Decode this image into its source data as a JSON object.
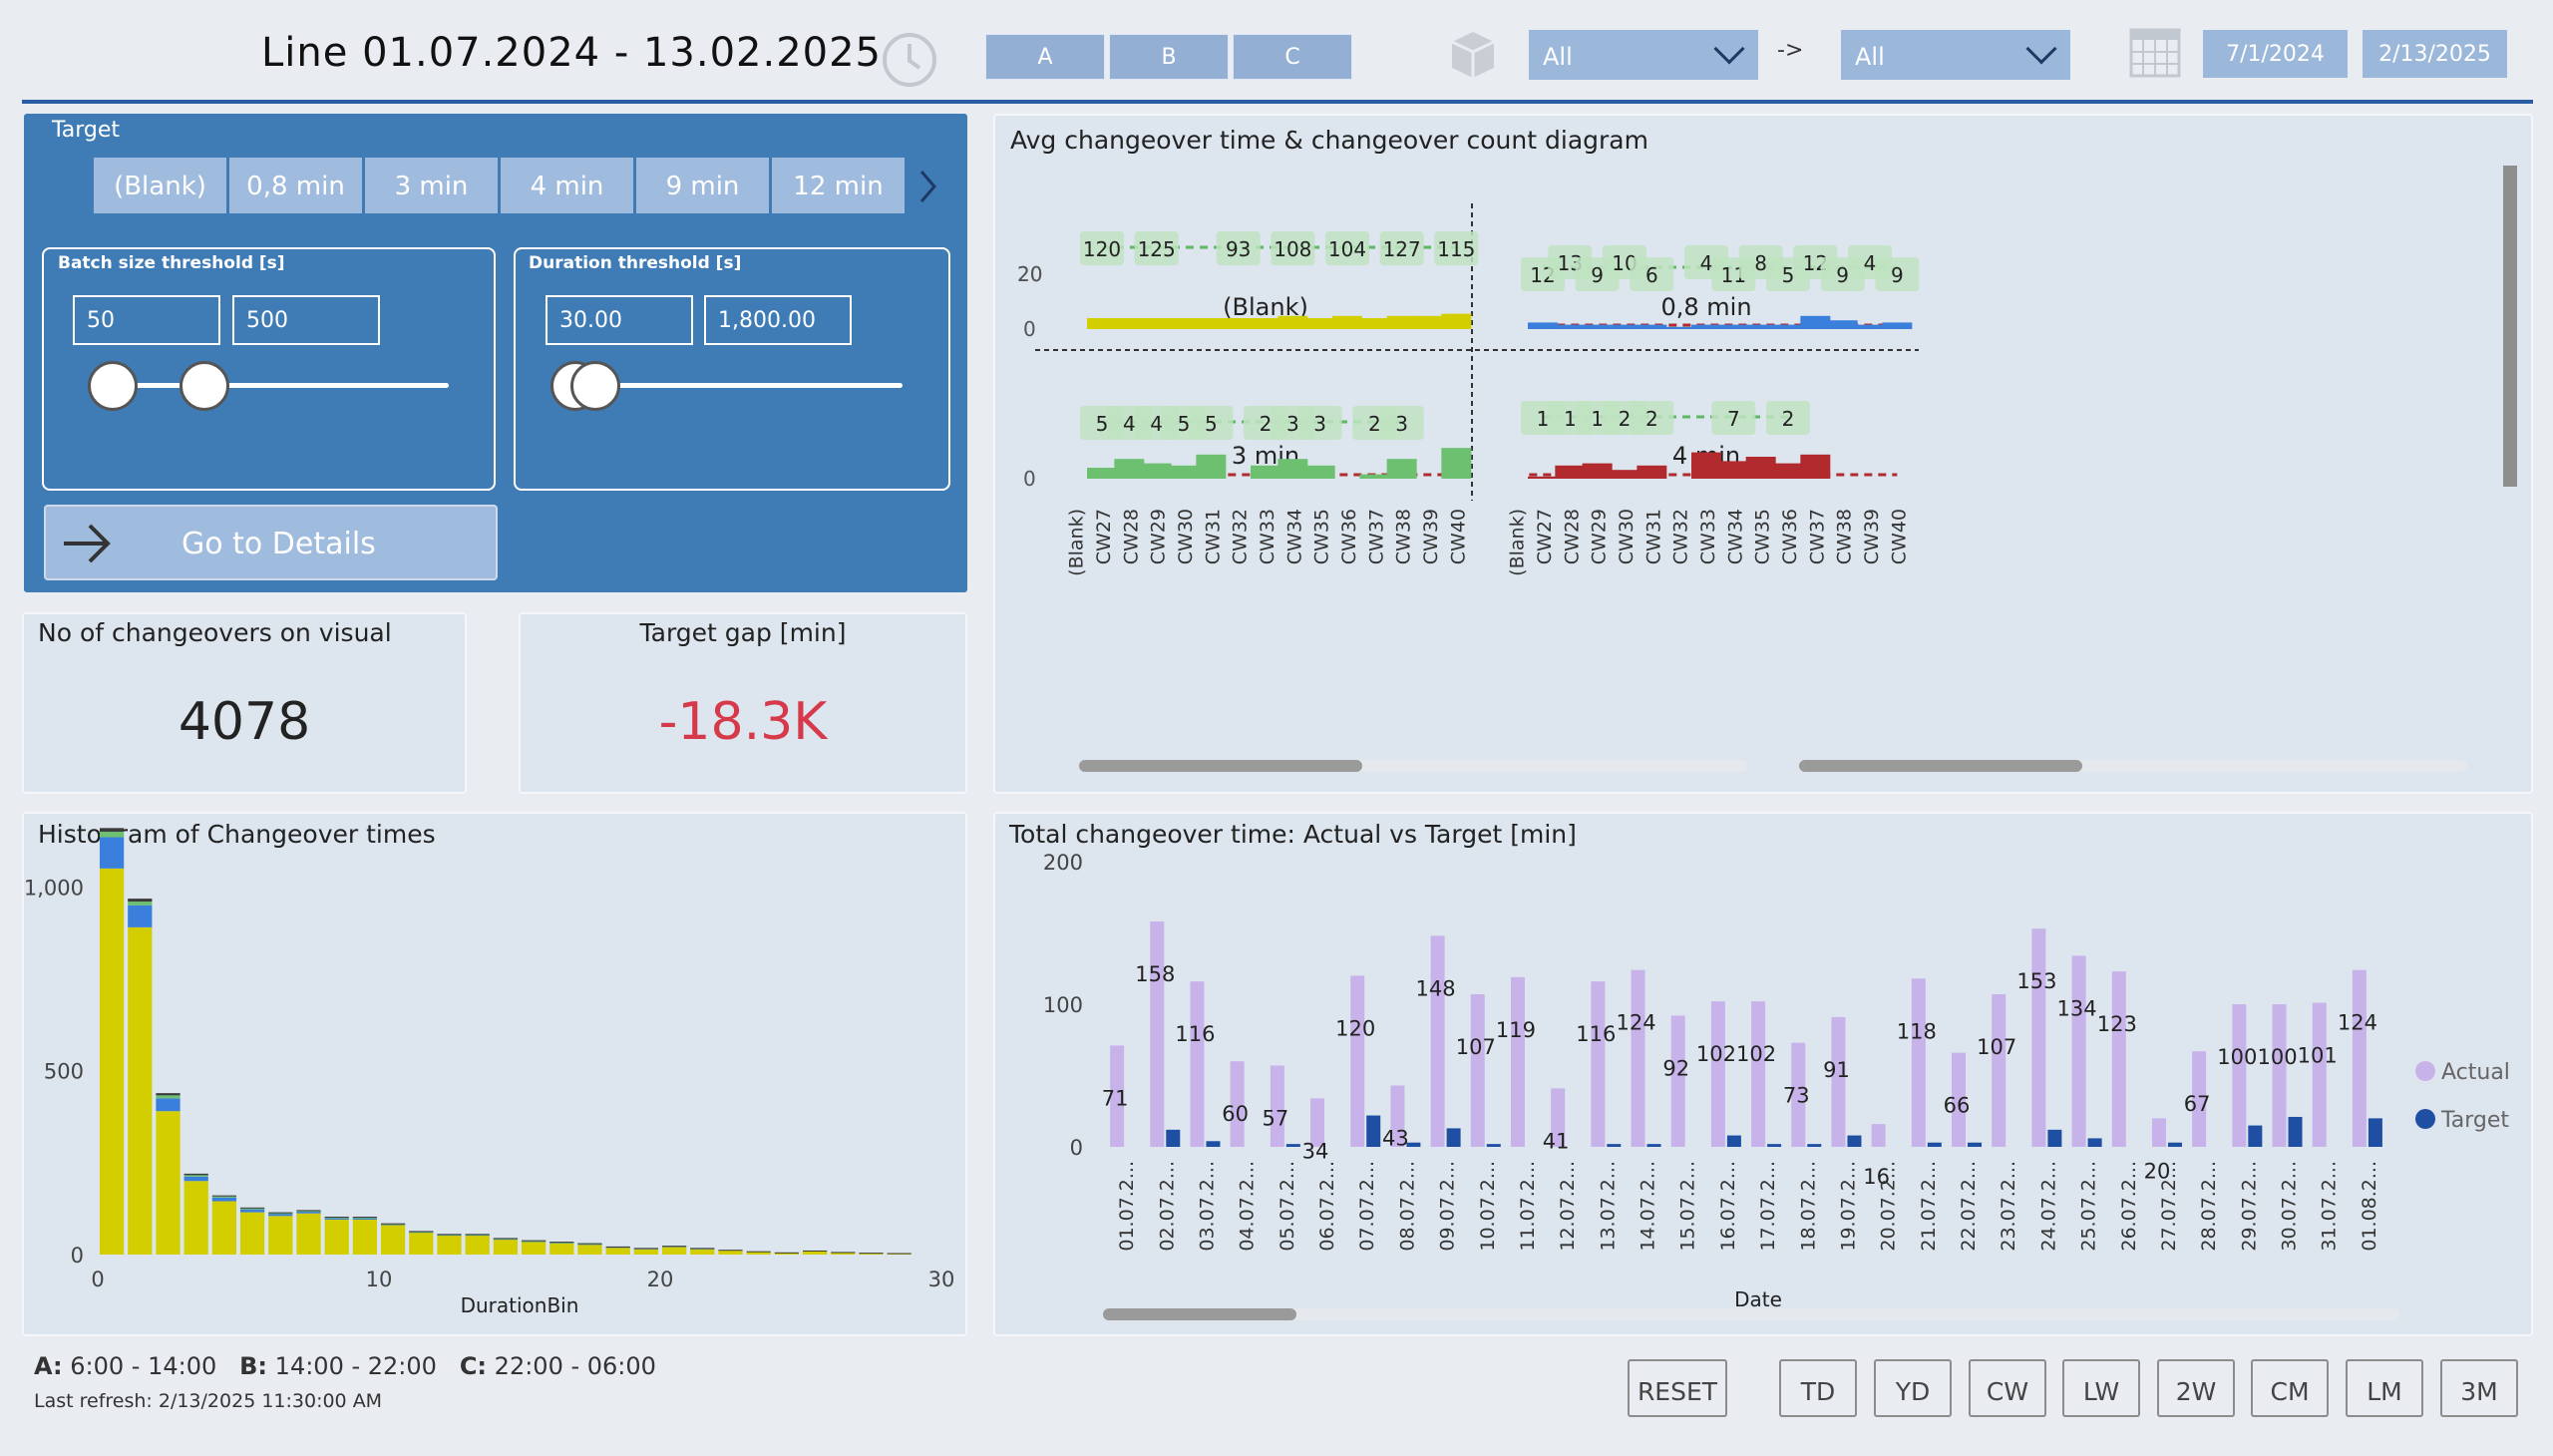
{
  "header": {
    "title": "Line 01.07.2024 - 13.02.2025",
    "shifts": [
      "A",
      "B",
      "C"
    ],
    "filter1": "All",
    "arrow": "->",
    "filter2": "All",
    "date_from": "7/1/2024",
    "date_to": "2/13/2025"
  },
  "target": {
    "label": "Target",
    "buttons": [
      "(Blank)",
      "0,8 min",
      "3 min",
      "4 min",
      "9 min",
      "12 min"
    ],
    "batch": {
      "title": "Batch size threshold [s]",
      "min": "50",
      "max": "500",
      "low_frac": 0.0,
      "high_frac": 0.28
    },
    "duration": {
      "title": "Duration threshold [s]",
      "min": "30.00",
      "max": "1,800.00",
      "low_frac": 0.0,
      "high_frac": 0.02
    },
    "details_label": "Go to Details"
  },
  "cards": {
    "count_title": "No of changeovers on visual",
    "count_value": "4078",
    "gap_title": "Target gap [min]",
    "gap_value": "-18.3K"
  },
  "small_multiples": {
    "title": "Avg changeover time & changeover count diagram",
    "y_ticks": [
      "20",
      "0"
    ],
    "categories": [
      "(Blank)",
      "CW27",
      "CW28",
      "CW29",
      "CW30",
      "CW31",
      "CW32",
      "CW33",
      "CW34",
      "CW35",
      "CW36",
      "CW37",
      "CW38",
      "CW39",
      "CW40"
    ],
    "panels": [
      {
        "title": "(Blank)",
        "bar_color": "#d3ce00",
        "avg": [
          0,
          5,
          5,
          5,
          5,
          5,
          5,
          5,
          6,
          5,
          6,
          5,
          6,
          6,
          7
        ],
        "labels": [
          [
            "CW27",
            "120"
          ],
          [
            "CW29",
            "125"
          ],
          [
            "CW32",
            "93"
          ],
          [
            "CW34",
            "108"
          ],
          [
            "CW36",
            "104"
          ],
          [
            "CW38",
            "127"
          ],
          [
            "CW40",
            "115"
          ]
        ]
      },
      {
        "title": "0,8 min",
        "bar_color": "#3b7fdc",
        "avg": [
          0,
          3,
          2,
          2,
          2,
          2,
          1,
          2,
          2,
          2,
          2,
          6,
          4,
          2,
          3
        ],
        "labels": [
          [
            "CW27",
            "12"
          ],
          [
            "CW28",
            "13"
          ],
          [
            "CW29",
            "9"
          ],
          [
            "CW30",
            "10"
          ],
          [
            "CW31",
            "6"
          ],
          [
            "CW33",
            "4"
          ],
          [
            "CW34",
            "11"
          ],
          [
            "CW35",
            "8"
          ],
          [
            "CW36",
            "5"
          ],
          [
            "CW37",
            "12"
          ],
          [
            "CW38",
            "9"
          ],
          [
            "CW39",
            "4"
          ],
          [
            "CW40",
            "9"
          ]
        ]
      },
      {
        "title": "3 min",
        "bar_color": "#6cc06f",
        "avg": [
          0,
          5,
          9,
          7,
          6,
          11,
          0,
          6,
          9,
          6,
          0,
          2,
          9,
          0,
          14
        ],
        "labels": [
          [
            "CW27",
            "5"
          ],
          [
            "CW28",
            "4"
          ],
          [
            "CW29",
            "4"
          ],
          [
            "CW30",
            "5"
          ],
          [
            "CW31",
            "5"
          ],
          [
            "CW33",
            "2"
          ],
          [
            "CW34",
            "3"
          ],
          [
            "CW35",
            "3"
          ],
          [
            "CW37",
            "2"
          ],
          [
            "CW38",
            "3"
          ]
        ]
      },
      {
        "title": "4 min",
        "bar_color": "#b02a2e",
        "avg": [
          0,
          1,
          6,
          7,
          4,
          6,
          0,
          12,
          8,
          10,
          7,
          11,
          0,
          0,
          0
        ],
        "labels": [
          [
            "CW27",
            "1"
          ],
          [
            "CW28",
            "1"
          ],
          [
            "CW29",
            "1"
          ],
          [
            "CW30",
            "2"
          ],
          [
            "CW31",
            "2"
          ],
          [
            "CW34",
            "7"
          ],
          [
            "CW36",
            "2"
          ]
        ]
      }
    ]
  },
  "histogram": {
    "title": "Histogram of Changeover times",
    "xlabel": "DurationBin",
    "x_ticks": [
      "0",
      "10",
      "20",
      "30"
    ],
    "y_ticks": [
      "1,000",
      "500",
      "0"
    ]
  },
  "total": {
    "title": "Total changeover time: Actual vs Target [min]",
    "xlabel": "Date",
    "y_ticks": [
      "200",
      "100",
      "0"
    ],
    "legend_actual": "Actual",
    "legend_target": "Target"
  },
  "footer": {
    "shift_a_key": "A:",
    "shift_a_val": "6:00 - 14:00",
    "shift_b_key": "B:",
    "shift_b_val": "14:00 - 22:00",
    "shift_c_key": "C:",
    "shift_c_val": "22:00 - 06:00",
    "refresh": "Last refresh: 2/13/2025 11:30:00 AM",
    "buttons": [
      "RESET",
      "TD",
      "YD",
      "CW",
      "LW",
      "2W",
      "CM",
      "LM",
      "3M"
    ]
  },
  "chart_data": [
    {
      "type": "bar",
      "title": "Histogram of Changeover times",
      "xlabel": "DurationBin",
      "ylabel": "",
      "xlim": [
        0,
        30
      ],
      "ylim": [
        0,
        1150
      ],
      "x": [
        1,
        2,
        3,
        4,
        5,
        6,
        7,
        8,
        9,
        10,
        11,
        12,
        13,
        14,
        15,
        16,
        17,
        18,
        19,
        20,
        21,
        22,
        23,
        24,
        25,
        26,
        27,
        28,
        29
      ],
      "series": [
        {
          "color": "#d3ce00",
          "values": [
            1050,
            890,
            390,
            200,
            145,
            115,
            105,
            112,
            95,
            95,
            80,
            60,
            52,
            52,
            42,
            36,
            32,
            28,
            20,
            16,
            22,
            16,
            12,
            8,
            5,
            10,
            6,
            4,
            3
          ]
        },
        {
          "color": "#3b7fdc",
          "values": [
            85,
            60,
            35,
            12,
            10,
            8,
            6,
            5,
            4,
            4,
            3,
            2,
            2,
            2,
            1,
            1,
            1,
            1,
            1,
            1,
            1,
            1,
            0,
            0,
            0,
            0,
            0,
            0,
            0
          ]
        },
        {
          "color": "#6cc06f",
          "values": [
            15,
            10,
            8,
            4,
            3,
            3,
            2,
            2,
            2,
            2,
            1,
            1,
            1,
            1,
            1,
            1,
            1,
            1,
            0,
            0,
            0,
            0,
            0,
            0,
            0,
            0,
            0,
            0,
            0
          ]
        },
        {
          "color": "#3b3b3b",
          "values": [
            10,
            8,
            6,
            4,
            3,
            2,
            2,
            2,
            2,
            2,
            1,
            1,
            1,
            1,
            1,
            1,
            1,
            1,
            1,
            1,
            1,
            1,
            1,
            1,
            1,
            1,
            1,
            1,
            1
          ]
        }
      ]
    },
    {
      "type": "bar",
      "title": "Total changeover time: Actual vs Target [min]",
      "xlabel": "Date",
      "ylabel": "",
      "ylim": [
        0,
        200
      ],
      "categories": [
        "01.07.2...",
        "02.07.2...",
        "03.07.2...",
        "04.07.2...",
        "05.07.2...",
        "06.07.2...",
        "07.07.2...",
        "08.07.2...",
        "09.07.2...",
        "10.07.2...",
        "11.07.2...",
        "12.07.2...",
        "13.07.2...",
        "14.07.2...",
        "15.07.2...",
        "16.07.2...",
        "17.07.2...",
        "18.07.2...",
        "19.07.2...",
        "20.07.2...",
        "21.07.2...",
        "22.07.2...",
        "23.07.2...",
        "24.07.2...",
        "25.07.2...",
        "26.07.2...",
        "27.07.2...",
        "28.07.2...",
        "29.07.2...",
        "30.07.2...",
        "31.07.2...",
        "01.08.2..."
      ],
      "series": [
        {
          "name": "Actual",
          "color": "#c7b3ea",
          "values": [
            71,
            158,
            116,
            60,
            57,
            34,
            120,
            43,
            148,
            107,
            119,
            41,
            116,
            124,
            92,
            102,
            102,
            73,
            91,
            16,
            118,
            66,
            107,
            153,
            134,
            123,
            20,
            67,
            100,
            100,
            101,
            124
          ]
        },
        {
          "name": "Target",
          "color": "#1f4fa3",
          "values": [
            0,
            12,
            4,
            0,
            2,
            0,
            22,
            3,
            13,
            2,
            0,
            0,
            2,
            2,
            0,
            8,
            2,
            2,
            8,
            0,
            3,
            3,
            0,
            12,
            6,
            0,
            3,
            0,
            15,
            21,
            0,
            20
          ]
        }
      ]
    }
  ]
}
